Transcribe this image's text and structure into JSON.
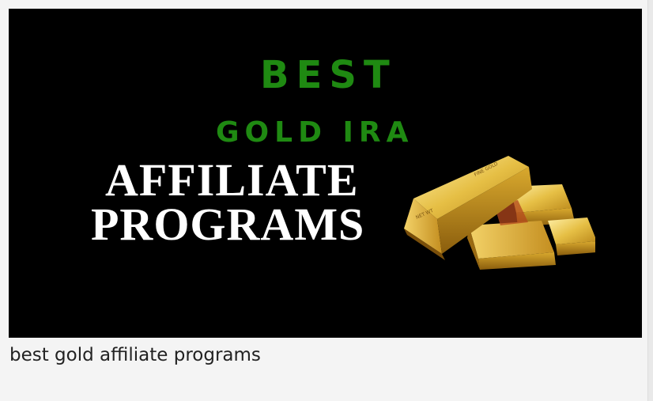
{
  "image": {
    "line1": "BEST",
    "line2": "GOLD IRA",
    "line3": "AFFILIATE",
    "line4": "PROGRAMS",
    "bar_stamp_1": "FINE GOLD",
    "bar_stamp_2": "NET WT",
    "colors": {
      "background": "#000000",
      "green_text": "#1f8a12",
      "white_text": "#ffffff",
      "gold": "#d4a72c"
    },
    "illustration": "gold-bars-icon"
  },
  "caption": {
    "text": "best gold affiliate programs"
  }
}
